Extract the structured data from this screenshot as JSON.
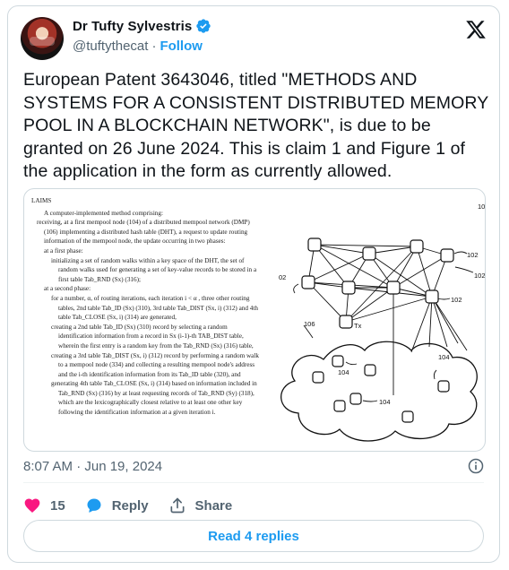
{
  "author": {
    "name": "Dr Tufty Sylvestris",
    "handle": "@tuftythecat",
    "separator": "·",
    "follow_label": "Follow"
  },
  "tweet": {
    "text": "European Patent 3643046, titled \"METHODS AND SYSTEMS FOR A CONSISTENT DISTRIBUTED MEMORY POOL IN A BLOCKCHAIN NETWORK\", is due to be granted on 26 June 2024. This is claim 1 and Figure 1 of the application in the form as currently allowed.",
    "timestamp": "8:07 AM · Jun 19, 2024"
  },
  "figure": {
    "claims_heading": "LAIMS",
    "claims_lines": [
      "A computer-implemented method comprising:",
      "receiving, at a first mempool node (104) of a distributed mempool network (DMP)",
      "(106) implementing a distributed hash table (DHT), a request to update routing",
      "information of the mempool node, the update occurring in two phases:",
      "at a first phase:",
      "initializing a set of random walks within a key space of the DHT, the set of",
      "random walks used for generating a set of key-value records to be stored in a",
      "first table Tab_RND (Sx) (316);",
      "at a second phase:",
      "for a number, α, of routing iterations, each iteration i < α , three other routing",
      "tables, 2nd table Tab_ID (Sx) (310), 3rd table Tab_DIST (Sx, i) (312) and 4th",
      "table Tab_CLOSE (Sx, i) (314) are generated,",
      "creating a 2nd table Tab_ID (Sx) (310) record by selecting a random",
      "identification information from a record in Sx (i-1)-th TAB_DIST table,",
      "wherein the first entry is a random key from the Tab_RND (Sx) (316) table,",
      "creating a 3rd table Tab_DIST (Sx, i) (312) record by performing a random walk",
      "to a mempool node (334) and collecting a resulting mempool node's address",
      "and the i-th identification information from its Tab_ID table (320), and",
      "generating 4th table Tab_CLOSE (Sx, i) (314) based on information included in",
      "Tab_RND (Sx) (316) by at least requesting records of Tab_RND (Sy) (318),",
      "which are the lexicographically closest relative to at least one other key",
      "following the identification information at a given iteration i."
    ],
    "diagram_labels": {
      "top_right": "10",
      "ref_102_a": "102",
      "ref_102_b": "102",
      "ref_102_c": "102",
      "ref_02": "02",
      "ref_106": "106",
      "ref_104_a": "104",
      "ref_104_b": "104",
      "ref_104_c": "104",
      "tx": "Tx"
    }
  },
  "actions": {
    "like_count": "15",
    "reply_label": "Reply",
    "share_label": "Share"
  },
  "read_replies_label": "Read 4 replies",
  "colors": {
    "accent": "#1d9bf0",
    "like": "#f91880",
    "text_secondary": "#536471",
    "border": "#cfd9de"
  },
  "icons": [
    "verified-badge-icon",
    "x-logo-icon",
    "info-icon",
    "heart-icon",
    "reply-bubble-icon",
    "share-icon"
  ]
}
